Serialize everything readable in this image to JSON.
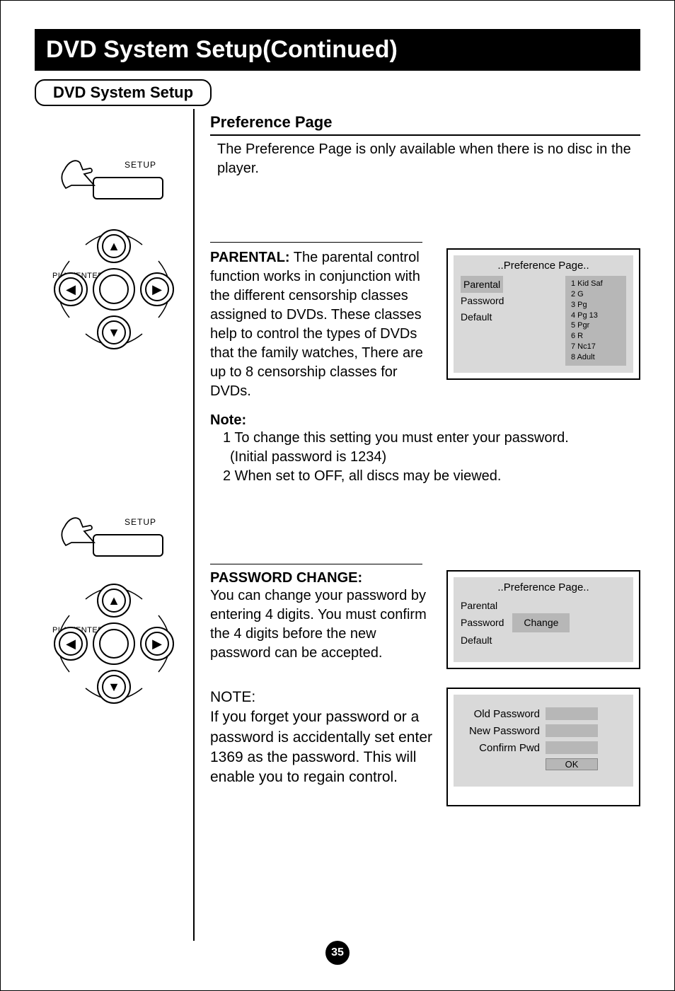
{
  "title_bar": "DVD System Setup(Continued)",
  "tab_label": "DVD System Setup",
  "remote_button_label": "SETUP",
  "dpad_center_label": "PLAY/ENTER",
  "preference": {
    "heading": "Preference Page",
    "intro": "The Preference Page is only available when there is no disc in the player.",
    "osd": {
      "title": "..Preference Page..",
      "left_items": [
        "Parental",
        "Password",
        "Default"
      ],
      "selected_index": 0,
      "right_items": [
        "1 Kid Saf",
        "2 G",
        "3 Pg",
        "4 Pg 13",
        "5 Pgr",
        "6 R",
        "7 Nc17",
        "8 Adult"
      ]
    },
    "parental": {
      "label": "PARENTAL:",
      "text_after": "  The parental control function works in conjunction   with  the different  censorship  classes assigned to DVDs. These classes help to control the types of DVDs that the family watches, There are up to 8 censorship classes for DVDs."
    },
    "note_label": "Note:",
    "note_1": "1 To change this setting you must enter your password.",
    "note_1b": "(Initial password is 1234)",
    "note_2": "2 When set to OFF, all discs may be viewed."
  },
  "password": {
    "heading": "PASSWORD CHANGE:",
    "text": "You can change your password by entering 4 digits. You must confirm the 4 digits before the new password can be accepted.",
    "osd": {
      "title": "..Preference Page..",
      "left_items": [
        "Parental",
        "Password",
        "Default"
      ],
      "selected_index": 1,
      "action_label": "Change"
    },
    "pwd_form": {
      "old_label": "Old Password",
      "new_label": "New Password",
      "confirm_label": "Confirm Pwd",
      "ok_label": "OK"
    },
    "note_heading": "NOTE:",
    "note_text": "If you forget your password or a password is accidentally set enter 1369 as the password. This will enable you to regain control."
  },
  "page_number": "35"
}
